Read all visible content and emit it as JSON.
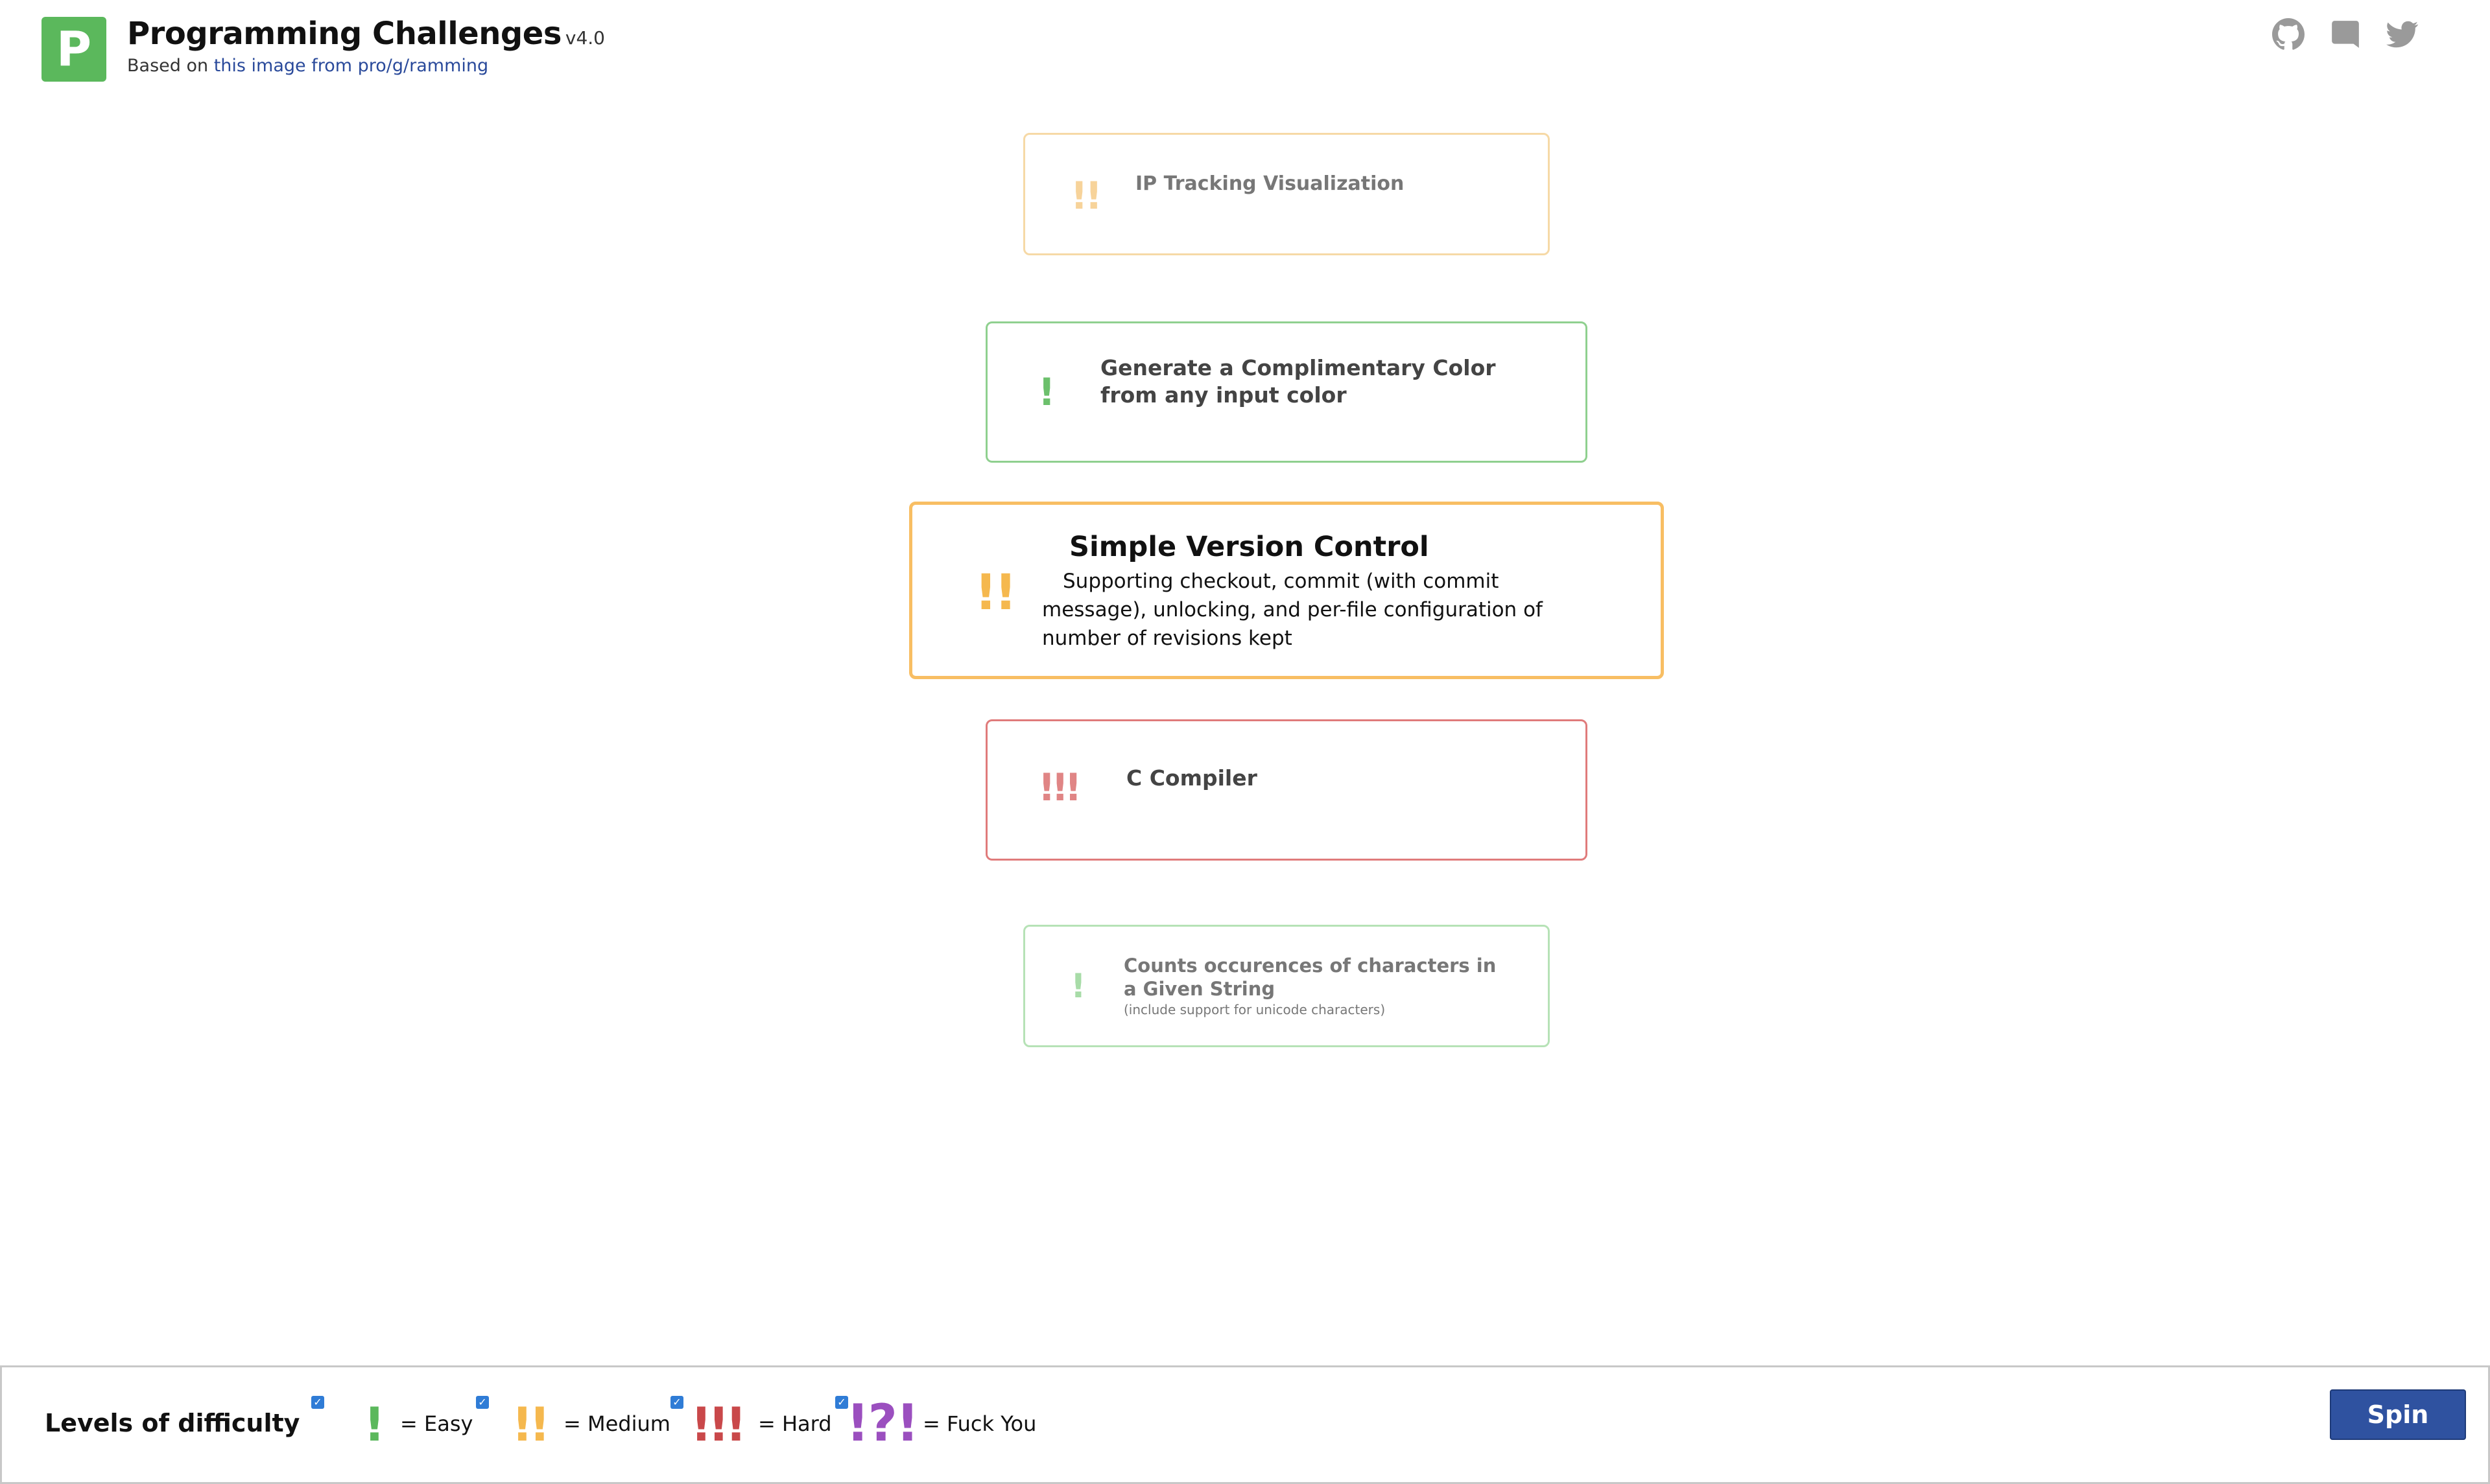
{
  "header": {
    "logo_letter": "P",
    "title": "Programming Challenges",
    "version": "v4.0",
    "subtitle_prefix": "Based on ",
    "subtitle_link": "this image from pro/g/ramming",
    "icons": [
      "github-icon",
      "discord-icon",
      "twitter-icon"
    ],
    "accent_color": "#5bb85c"
  },
  "challenges": [
    {
      "mark": "!!",
      "difficulty": "medium",
      "title": "IP Tracking Visualization",
      "description": ""
    },
    {
      "mark": "!",
      "difficulty": "easy",
      "title": "Generate a Complimentary Color from any input color",
      "description": ""
    },
    {
      "mark": "!!",
      "difficulty": "medium",
      "title": "Simple Version Control",
      "description": "Supporting checkout, commit (with commit message), unlocking, and per-file configuration of number of revisions kept"
    },
    {
      "mark": "!!!",
      "difficulty": "hard",
      "title": "C Compiler",
      "description": ""
    },
    {
      "mark": "!",
      "difficulty": "easy",
      "title": "Counts occurences of characters in a Given String",
      "description": "(include support for unicode characters)"
    }
  ],
  "footer": {
    "levels_label": "Levels of difficulty",
    "levels": [
      {
        "mark": "!",
        "label": "= Easy",
        "color": "#5bb85c",
        "checked": true
      },
      {
        "mark": "!!",
        "label": "= Medium",
        "color": "#f5b84e",
        "checked": true
      },
      {
        "mark": "!!!",
        "label": "= Hard",
        "color": "#c9484a",
        "checked": true
      },
      {
        "mark": "!?!",
        "label": "= Fuck You",
        "color": "#9b4fbf",
        "checked": true
      }
    ],
    "spin_label": "Spin"
  }
}
